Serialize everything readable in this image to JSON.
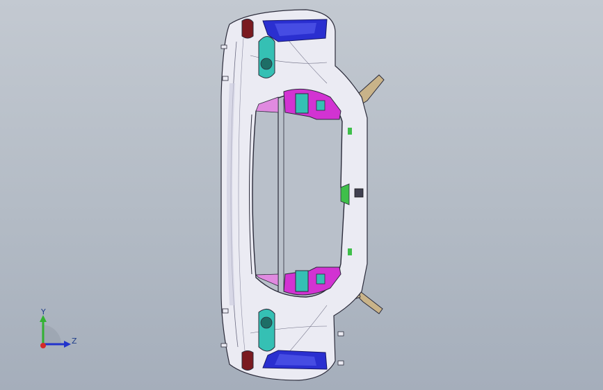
{
  "viewport": {
    "background_top": "#c3c9d1",
    "background_bottom": "#a5aebb"
  },
  "model": {
    "description_icon": "bumper-assembly-model",
    "colors": {
      "body": "#ebebf3",
      "edge": "#2b2b3a",
      "magenta_bracket": "#d233d2",
      "cyan_part": "#35c0b4",
      "blue_part": "#2a2fd0",
      "lamp_red": "#7a1a20",
      "bracket_tan": "#c9b389",
      "green_marker": "#3fbf4a"
    }
  },
  "triad": {
    "y_label": "Y",
    "z_label": "Z",
    "y_color": "#33b233",
    "z_color": "#2233cc",
    "origin_color": "#d42a2a"
  }
}
